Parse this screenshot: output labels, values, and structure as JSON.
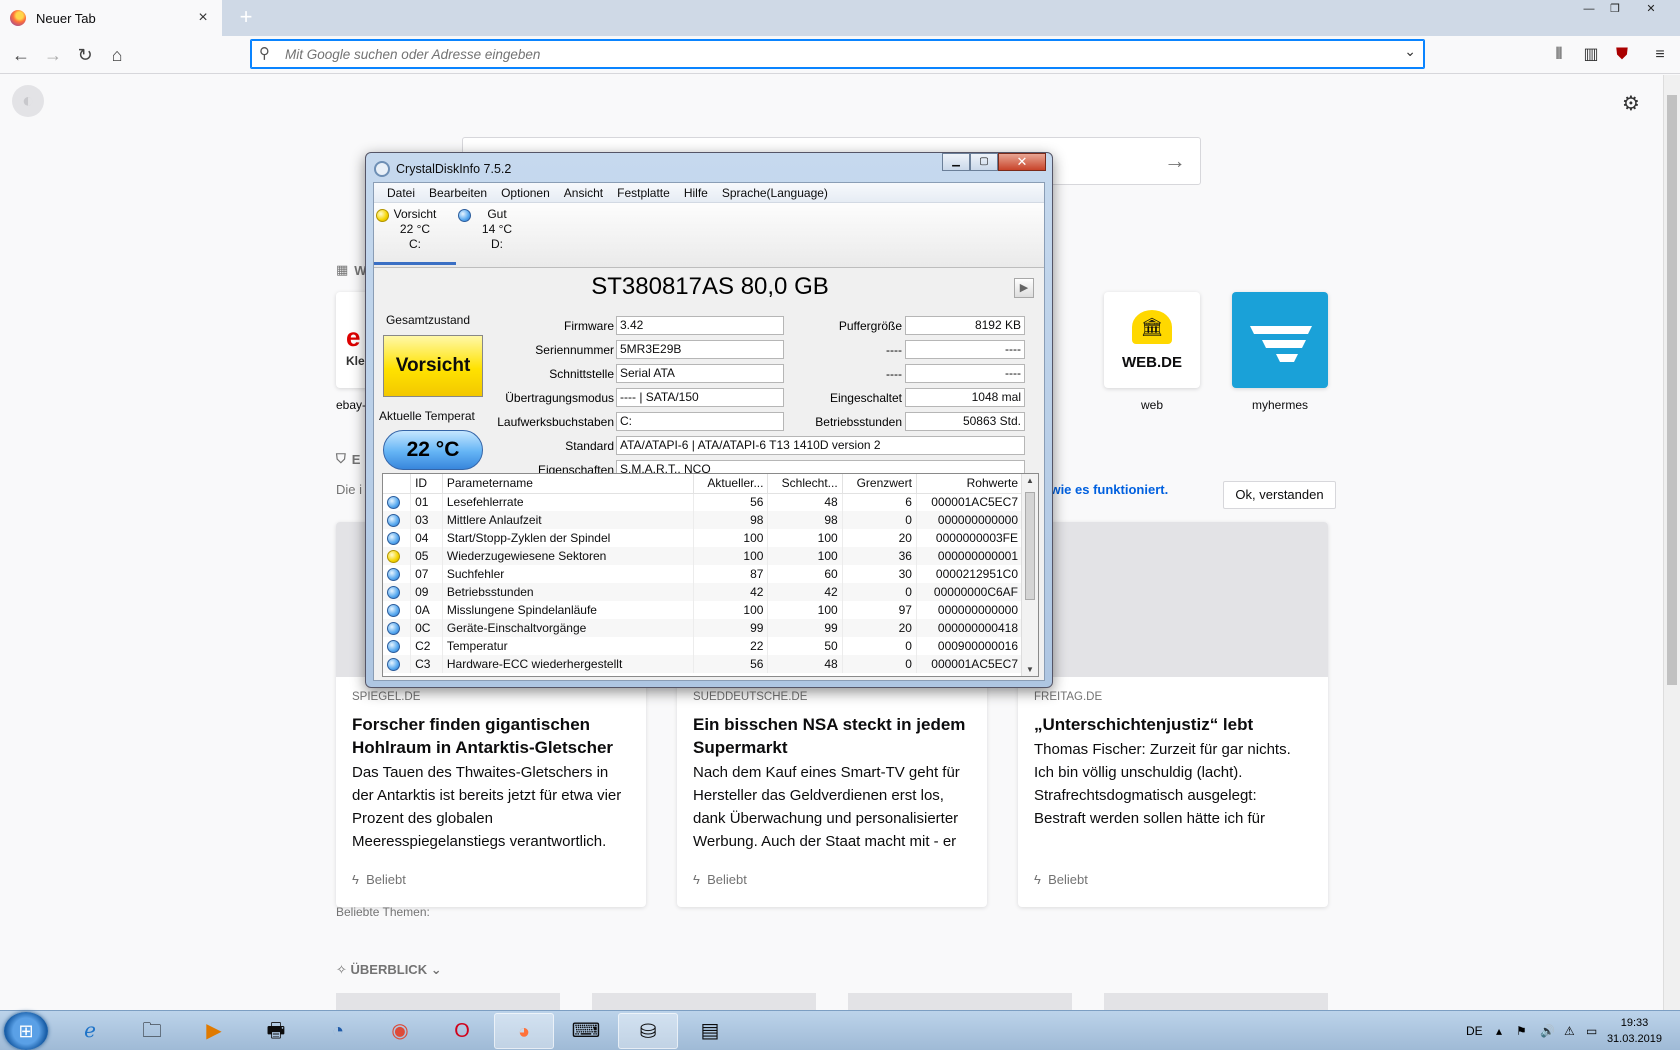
{
  "browser": {
    "tab_title": "Neuer Tab",
    "tab_close": "×",
    "new_tab": "+",
    "url_placeholder": "Mit Google suchen oder Adresse eingeben"
  },
  "newtab": {
    "section_topsites": "W",
    "tiles": [
      {
        "label": "ebay-",
        "text": "Klei"
      },
      {
        "label": "web",
        "text": "WEB.DE"
      },
      {
        "label": "myhermes",
        "text": ""
      }
    ],
    "section_pocket": "E",
    "pocket_intro": "Die i",
    "pocket_link": "e, wie es funktioniert.",
    "ok_button": "Ok, verstanden",
    "cards": [
      {
        "source": "SPIEGEL.DE",
        "title": "Forscher finden gigantischen Hohlraum in Antarktis-Gletscher",
        "desc": "Das Tauen des Thwaites-Gletschers in der Antarktis ist bereits jetzt für etwa vier Prozent des globalen Meeresspiegelanstiegs verantwortlich.",
        "context": "Beliebt"
      },
      {
        "source": "SUEDDEUTSCHE.DE",
        "title": "Ein bisschen NSA steckt in jedem Supermarkt",
        "desc": "Nach dem Kauf eines Smart-TV geht für Hersteller das Geldverdienen erst los, dank Überwachung und personalisierter Werbung. Auch der Staat macht mit - er",
        "context": "Beliebt"
      },
      {
        "source": "FREITAG.DE",
        "title": "„Unterschichtenjustiz“ lebt",
        "desc": "Thomas Fischer: Zurzeit für gar nichts. Ich bin völlig unschuldig (lacht). Strafrechtsdogmatisch ausgelegt: Bestraft werden sollen hätte ich für nichts, bestraft werden können für kleinere Straftaten in",
        "context": "Beliebt"
      }
    ],
    "topics": "Beliebte Themen:",
    "overview": "ÜBERBLICK"
  },
  "cdi": {
    "title": "CrystalDiskInfo 7.5.2",
    "menu": [
      "Datei",
      "Bearbeiten",
      "Optionen",
      "Ansicht",
      "Festplatte",
      "Hilfe",
      "Sprache(Language)"
    ],
    "drives": [
      {
        "status": "Vorsicht",
        "temp": "22 °C",
        "letter": "C:",
        "color": "yellow"
      },
      {
        "status": "Gut",
        "temp": "14 °C",
        "letter": "D:",
        "color": "blue"
      }
    ],
    "model": "ST380817AS 80,0 GB",
    "play": "▶",
    "health_label": "Gesamtzustand",
    "health_value": "Vorsicht",
    "temp_label": "Aktuelle Temperat",
    "temp_value": "22 °C",
    "fields": {
      "firmware_label": "Firmware",
      "firmware": "3.42",
      "serial_label": "Seriennummer",
      "serial": "5MR3E29B",
      "interface_label": "Schnittstelle",
      "interface": "Serial ATA",
      "transfer_label": "Übertragungsmodus",
      "transfer": "---- | SATA/150",
      "letters_label": "Laufwerksbuchstaben",
      "letters": "C:",
      "standard_label": "Standard",
      "standard": "ATA/ATAPI-6 | ATA/ATAPI-6 T13 1410D version 2",
      "features_label": "Eigenschaften",
      "features": "S.M.A.R.T., NCQ",
      "buffer_label": "Puffergröße",
      "buffer": "8192 KB",
      "dash1_label": "----",
      "dash1": "----",
      "dash2_label": "----",
      "dash2": "----",
      "poweron_label": "Eingeschaltet",
      "poweron": "1048 mal",
      "hours_label": "Betriebsstunden",
      "hours": "50863 Std."
    },
    "smart_headers": [
      "ID",
      "Parametername",
      "Aktueller...",
      "Schlecht...",
      "Grenzwert",
      "Rohwerte"
    ],
    "smart_rows": [
      {
        "status": "blue",
        "id": "01",
        "name": "Lesefehlerrate",
        "current": "56",
        "worst": "48",
        "threshold": "6",
        "raw": "000001AC5EC7"
      },
      {
        "status": "blue",
        "id": "03",
        "name": "Mittlere Anlaufzeit",
        "current": "98",
        "worst": "98",
        "threshold": "0",
        "raw": "000000000000"
      },
      {
        "status": "blue",
        "id": "04",
        "name": "Start/Stopp-Zyklen der Spindel",
        "current": "100",
        "worst": "100",
        "threshold": "20",
        "raw": "0000000003FE"
      },
      {
        "status": "yellow",
        "id": "05",
        "name": "Wiederzugewiesene Sektoren",
        "current": "100",
        "worst": "100",
        "threshold": "36",
        "raw": "000000000001"
      },
      {
        "status": "blue",
        "id": "07",
        "name": "Suchfehler",
        "current": "87",
        "worst": "60",
        "threshold": "30",
        "raw": "0000212951C0"
      },
      {
        "status": "blue",
        "id": "09",
        "name": "Betriebsstunden",
        "current": "42",
        "worst": "42",
        "threshold": "0",
        "raw": "00000000C6AF"
      },
      {
        "status": "blue",
        "id": "0A",
        "name": "Misslungene Spindelanläufe",
        "current": "100",
        "worst": "100",
        "threshold": "97",
        "raw": "000000000000"
      },
      {
        "status": "blue",
        "id": "0C",
        "name": "Geräte-Einschaltvorgänge",
        "current": "99",
        "worst": "99",
        "threshold": "20",
        "raw": "000000000418"
      },
      {
        "status": "blue",
        "id": "C2",
        "name": "Temperatur",
        "current": "22",
        "worst": "50",
        "threshold": "0",
        "raw": "000900000016"
      },
      {
        "status": "blue",
        "id": "C3",
        "name": "Hardware-ECC wiederhergestellt",
        "current": "56",
        "worst": "48",
        "threshold": "0",
        "raw": "000001AC5EC7"
      }
    ]
  },
  "taskbar": {
    "lang": "DE",
    "time": "19:33",
    "date": "31.03.2019"
  },
  "colors": {
    "accent": "#0a84ff",
    "caution_yellow": "#ffe200",
    "good_blue": "#56a8ef"
  }
}
